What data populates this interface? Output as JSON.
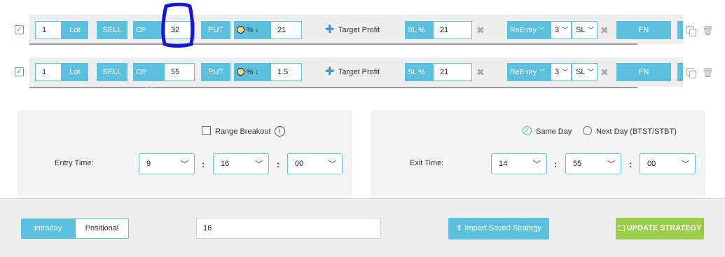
{
  "legs": [
    {
      "lots": "1",
      "lot_label": "Lot",
      "side": "SELL",
      "strike_criteria": "CP <=",
      "strike_value": "32",
      "option_type": "PUT",
      "target_type": "% ↓",
      "target_value": "21",
      "target_profit_label": "Target Profit",
      "sl_type": "SL %",
      "sl_value": "21",
      "reentry_label": "ReEntry",
      "reentry_count": "3",
      "reentry_type": "SL",
      "fn_label": "FN"
    },
    {
      "lots": "1",
      "lot_label": "Lot",
      "side": "SELL",
      "strike_criteria": "CP <=",
      "strike_value": "55",
      "option_type": "PUT",
      "target_type": "% ↓",
      "target_value": "1.5",
      "target_profit_label": "Target Profit",
      "sl_type": "SL %",
      "sl_value": "21",
      "reentry_label": "ReEntry",
      "reentry_count": "3",
      "reentry_type": "SL",
      "fn_label": "FN"
    }
  ],
  "entry": {
    "range_breakout_label": "Range Breakout",
    "entry_time_label": "Entry Time:",
    "hour": "9",
    "minute": "16",
    "second": "00"
  },
  "exit": {
    "same_day_label": "Same Day",
    "next_day_label": "Next Day (BTST/STBT)",
    "exit_time_label": "Exit Time:",
    "hour": "14",
    "minute": "55",
    "second": "00"
  },
  "footer": {
    "tab_intraday": "Intraday",
    "tab_positional": "Positional",
    "input_value": "16",
    "import_label": "Import Saved Strategy",
    "update_label": "UPDATE STRATEGY"
  },
  "colors": {
    "accent": "#5bc0de",
    "update_green": "#9acd4a",
    "annotation": "#1515d6"
  }
}
